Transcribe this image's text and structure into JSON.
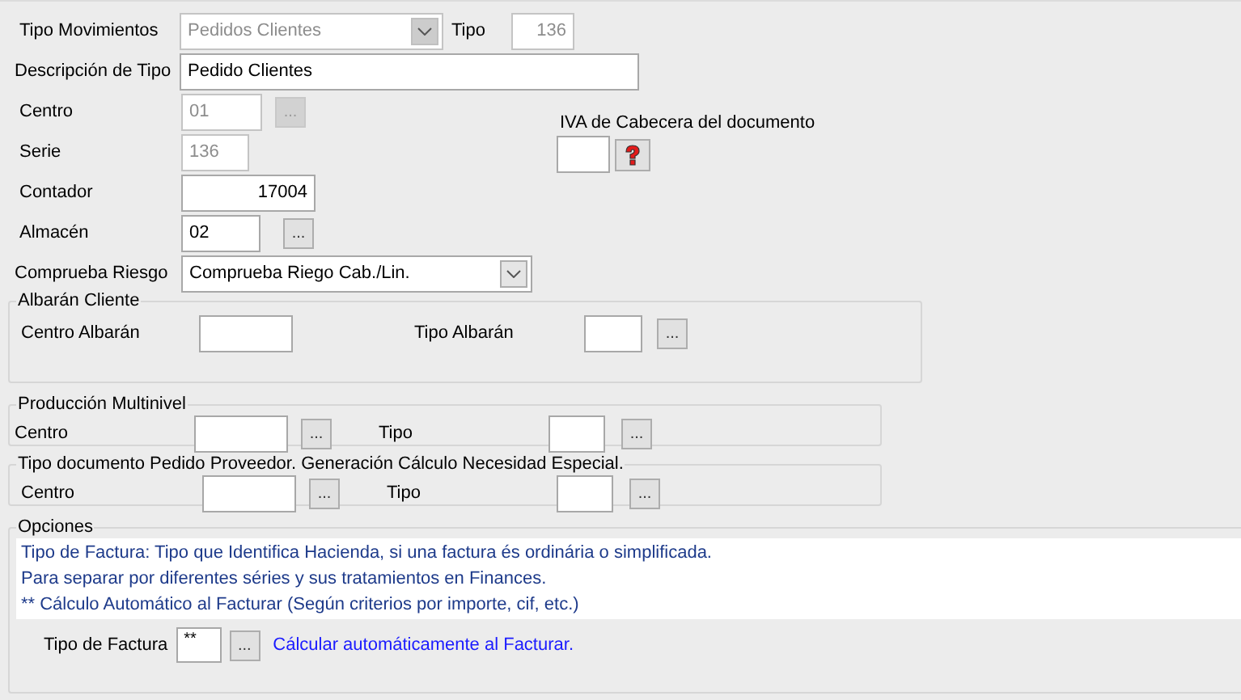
{
  "form": {
    "tipo_movimientos": {
      "label": "Tipo Movimientos",
      "value": "Pedidos Clientes",
      "disabled": true
    },
    "tipo": {
      "label": "Tipo",
      "value": "136",
      "disabled": true
    },
    "descripcion": {
      "label": "Descripción de Tipo",
      "value": "Pedido Clientes",
      "disabled": false
    },
    "centro": {
      "label": "Centro",
      "value": "01",
      "disabled": true,
      "button": {
        "label": "...",
        "disabled": true
      }
    },
    "serie": {
      "label": "Serie",
      "value": "136",
      "disabled": true
    },
    "iva": {
      "label": "IVA de Cabecera del documento"
    },
    "contador": {
      "label": "Contador",
      "value": "17004",
      "disabled": false
    },
    "almacen": {
      "label": "Almacén",
      "value": "02",
      "disabled": false,
      "button": {
        "label": "...",
        "disabled": false
      }
    },
    "comprueba_riesgo": {
      "label": "Comprueba Riesgo",
      "value": "Comprueba Riego Cab./Lin.",
      "disabled": false
    }
  },
  "groups": [
    {
      "title": "Albarán Cliente",
      "fields": [
        {
          "label": "Centro Albarán"
        },
        {
          "label": "Tipo Albarán",
          "button": {
            "label": "...",
            "disabled": false
          }
        }
      ]
    },
    {
      "title": "Producción Multinivel",
      "fields": [
        {
          "label": "Centro",
          "button": {
            "label": "...",
            "disabled": false
          }
        },
        {
          "label": "Tipo",
          "button": {
            "label": "...",
            "disabled": false
          }
        }
      ]
    },
    {
      "title": "Tipo documento Pedido Proveedor. Generación Cálculo Necesidad Especial.",
      "fields": [
        {
          "label": "Centro",
          "button": {
            "label": "...",
            "disabled": false
          }
        },
        {
          "label": "Tipo",
          "button": {
            "label": "...",
            "disabled": false
          }
        }
      ]
    }
  ],
  "opciones": {
    "title": "Opciones",
    "info_lines": [
      "Tipo de Factura: Tipo que Identifica Hacienda, si una factura és ordinária o simplificada.",
      "Para separar por diferentes séries y sus tratamientos en Finances.",
      "** Cálculo Automático al Facturar (Según criterios por importe, cif, etc.)"
    ],
    "tipo_factura": {
      "label": "Tipo de Factura",
      "value": "**",
      "button": {
        "label": "...",
        "disabled": false
      },
      "hint": "Cálcular automáticamente al Facturar."
    }
  }
}
